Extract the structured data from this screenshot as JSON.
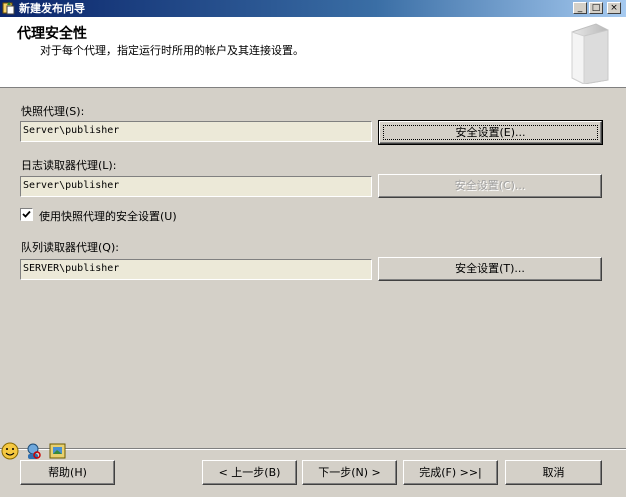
{
  "window": {
    "title": "新建发布向导",
    "minimize_glyph": "_",
    "maximize_glyph": "□",
    "close_glyph": "×"
  },
  "header": {
    "title": "代理安全性",
    "subtitle": "对于每个代理，指定运行时所用的帐户及其连接设置。"
  },
  "agents": {
    "snapshot": {
      "label": "快照代理(S):",
      "value": "Server\\publisher",
      "button": "安全设置(E)..."
    },
    "logreader": {
      "label": "日志读取器代理(L):",
      "value": "Server\\publisher",
      "button": "安全设置(C)..."
    },
    "use_snapshot_checkbox": {
      "label": "使用快照代理的安全设置(U)",
      "checked": true
    },
    "queuereader": {
      "label": "队列读取器代理(Q):",
      "value": "SERVER\\publisher",
      "button": "安全设置(T)..."
    }
  },
  "footer": {
    "help": "帮助(H)",
    "back": "< 上一步(B)",
    "next": "下一步(N) >",
    "finish": "完成(F) >>|",
    "cancel": "取消"
  },
  "colors": {
    "dialog_bg": "#d4d0c8",
    "titlebar_start": "#0a246a",
    "titlebar_end": "#a6caf0",
    "disabled_text": "#a0a0a0"
  }
}
